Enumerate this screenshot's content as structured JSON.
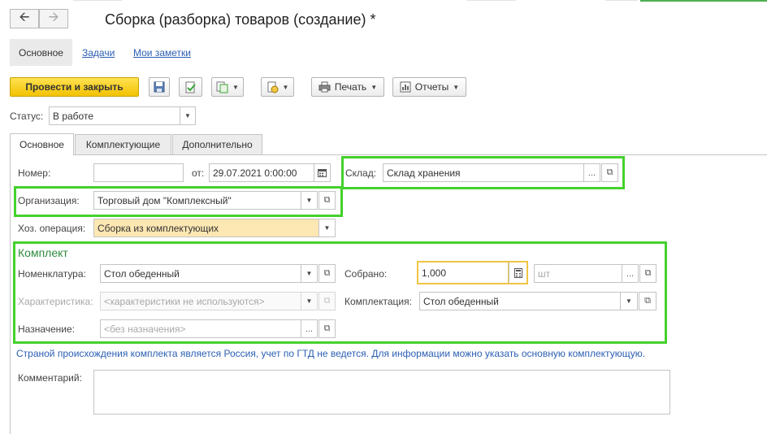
{
  "window": {
    "title": "Сборка (разборка) товаров (создание) *"
  },
  "sections": {
    "main": "Основное",
    "tasks": "Задачи",
    "notes": "Мои заметки"
  },
  "toolbar": {
    "post_close": "Провести и закрыть",
    "print": "Печать",
    "reports": "Отчеты"
  },
  "status": {
    "label": "Статус:",
    "value": "В работе"
  },
  "tabs": [
    "Основное",
    "Комплектующие",
    "Дополнительно"
  ],
  "form": {
    "number_label": "Номер:",
    "number_value": "",
    "date_label": "от:",
    "date_value": "29.07.2021  0:00:00",
    "warehouse_label": "Склад:",
    "warehouse_value": "Склад хранения",
    "org_label": "Организация:",
    "org_value": "Торговый дом \"Комплексный\"",
    "op_label": "Хоз. операция:",
    "op_value": "Сборка из комплектующих"
  },
  "kit": {
    "title": "Комплект",
    "nomenclature_label": "Номенклатура:",
    "nomenclature_value": "Стол обеденный",
    "characteristic_label": "Характеристика:",
    "characteristic_placeholder": "<характеристики не используются>",
    "purpose_label": "Назначение:",
    "purpose_placeholder": "<без назначения>",
    "assembled_label": "Собрано:",
    "assembled_value": "1,000",
    "unit_placeholder": "шт",
    "set_label": "Комплектация:",
    "set_value": "Стол обеденный"
  },
  "info_text": "Страной происхождения комплекта является Россия, учет по ГТД не ведется. Для информации можно указать основную комплектующую.",
  "comment": {
    "label": "Комментарий:",
    "value": ""
  },
  "colors": {
    "highlight": "#45d12d",
    "primary_button": "#f5c800",
    "link": "#2b5fb3",
    "group_title": "#2e8b3d",
    "operation_field": "#fde7b2"
  }
}
